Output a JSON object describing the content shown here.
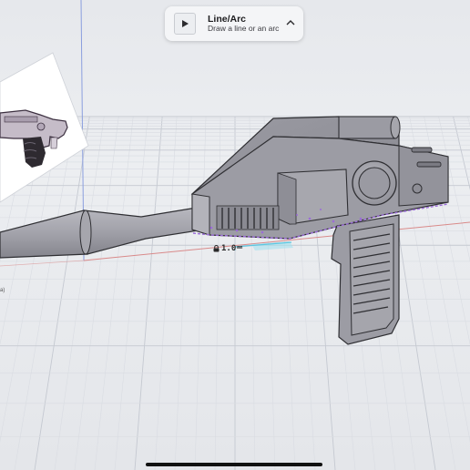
{
  "tool_card": {
    "title": "Line/Arc",
    "description": "Draw a line or an arc",
    "icon": "line-arc-thumbnail-icon",
    "collapse_icon": "chevron-up-icon"
  },
  "dimension": {
    "value": "1.0",
    "unit": "mm",
    "icon": "lock-icon"
  },
  "edge_glyph": "a)",
  "colors": {
    "canvas_background": "#e9ebef",
    "grid_major": "#c5c9d1",
    "grid_minor": "#d9dce2",
    "axis_red": "#d98a8a",
    "axis_blue": "#8a9ede",
    "model_body": "#a4a4ab",
    "model_edge": "#3a3a3e",
    "selection_purple": "#9b6bd8",
    "sketch_cyan": "#5cc6e0"
  }
}
